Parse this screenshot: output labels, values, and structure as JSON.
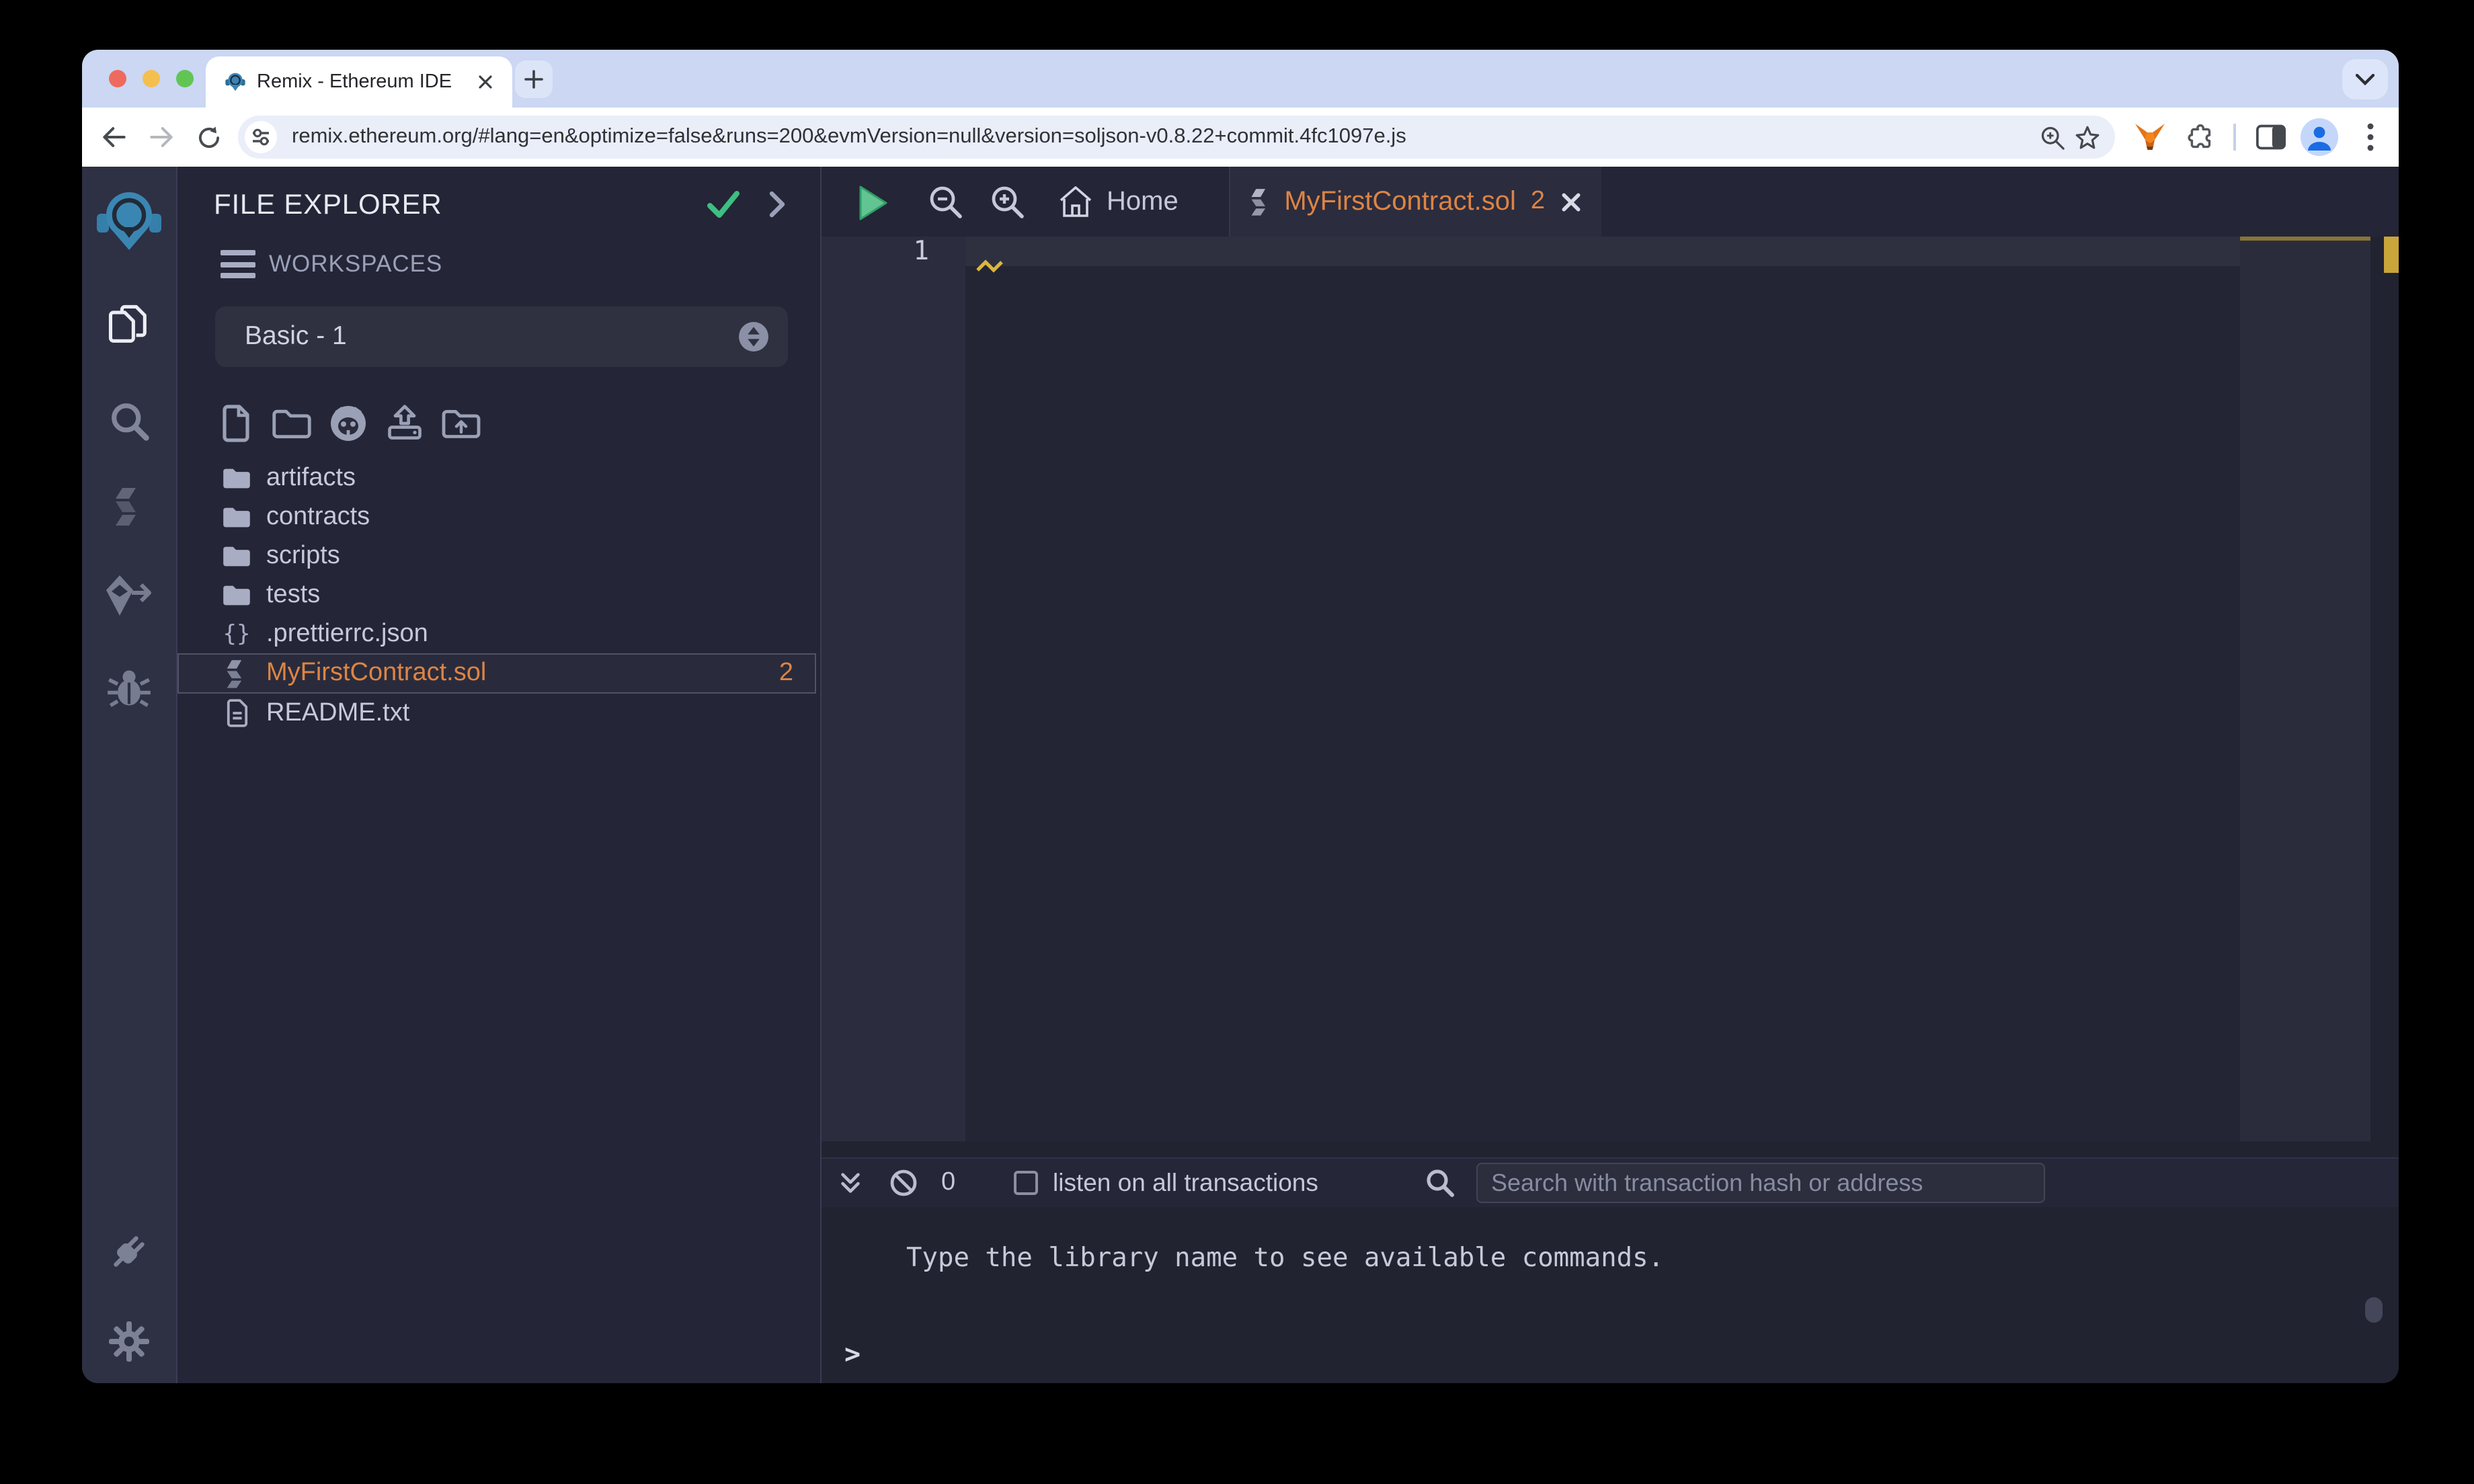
{
  "browser": {
    "tab_title": "Remix - Ethereum IDE",
    "url": "remix.ethereum.org/#lang=en&optimize=false&runs=200&evmVersion=null&version=soljson-v0.8.22+commit.4fc1097e.js"
  },
  "file_explorer": {
    "title": "FILE EXPLORER",
    "workspaces_label": "WORKSPACES",
    "workspace_selected": "Basic - 1",
    "brace_glyph": "{}",
    "files": [
      {
        "name": "artifacts",
        "type": "folder"
      },
      {
        "name": "contracts",
        "type": "folder"
      },
      {
        "name": "scripts",
        "type": "folder"
      },
      {
        "name": "tests",
        "type": "folder"
      },
      {
        "name": ".prettierrc.json",
        "type": "json"
      },
      {
        "name": "MyFirstContract.sol",
        "type": "solidity",
        "badge": "2",
        "selected": true
      },
      {
        "name": "README.txt",
        "type": "text"
      }
    ]
  },
  "editor": {
    "home_tab_label": "Home",
    "active_tab": {
      "name": "MyFirstContract.sol",
      "badge": "2"
    },
    "first_line_number": "1"
  },
  "terminal": {
    "count": "0",
    "listen_label": "listen on all transactions",
    "search_placeholder": "Search with transaction hash or address",
    "message": "Type the library name to see available commands.",
    "prompt": ">"
  },
  "colors": {
    "accent_orange": "#dd8444",
    "warning_yellow": "#c9a53a",
    "success_green": "#3dbf82",
    "chrome_strip": "#cbd7f3",
    "app_bg": "#242536"
  }
}
